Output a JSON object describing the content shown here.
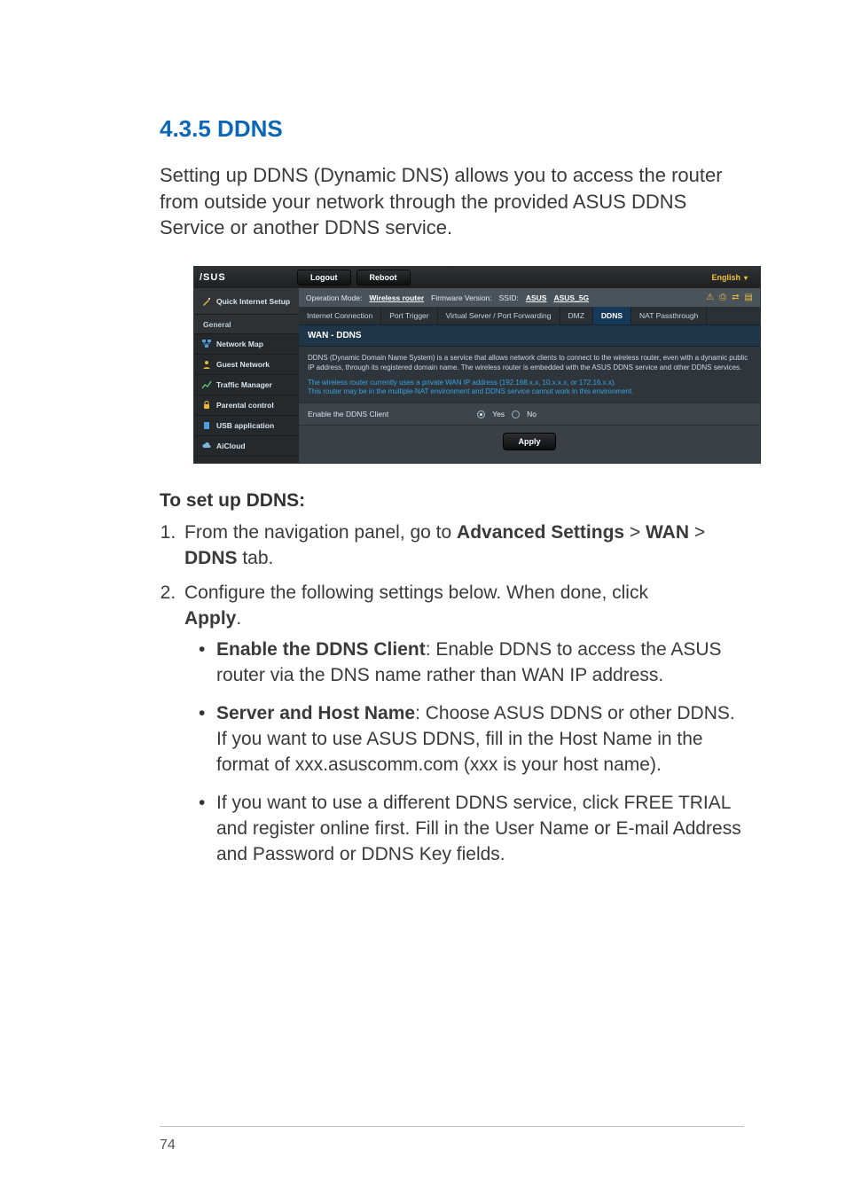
{
  "heading": "4.3.5 DDNS",
  "intro": "Setting up DDNS (Dynamic DNS) allows you to access the router from outside your network through the provided ASUS DDNS Service or another DDNS service.",
  "router": {
    "logo": "/SUS",
    "topButtons": {
      "logout": "Logout",
      "reboot": "Reboot"
    },
    "language": "English",
    "sidebar": {
      "qis": "Quick Internet Setup",
      "generalHeader": "General",
      "items": [
        "Network Map",
        "Guest Network",
        "Traffic Manager",
        "Parental control",
        "USB application",
        "AiCloud"
      ]
    },
    "opmode": {
      "label": "Operation Mode:",
      "mode": "Wireless router",
      "fwLabel": "Firmware Version:",
      "ssidLabel": "SSID:",
      "ssid1": "ASUS",
      "ssid2": "ASUS_5G"
    },
    "tabs": [
      "Internet Connection",
      "Port Trigger",
      "Virtual Server / Port Forwarding",
      "DMZ",
      "DDNS",
      "NAT Passthrough"
    ],
    "activeTab": "DDNS",
    "panelTitle": "WAN - DDNS",
    "desc1": "DDNS (Dynamic Domain Name System) is a service that allows network clients to connect to the wireless router, even with a dynamic public IP address, through its registered domain name. The wireless router is embedded with the ASUS DDNS service and other DDNS services.",
    "desc2a": "The wireless router currently uses a private WAN IP address (192.168.x.x, 10.x.x.x, or 172.16.x.x).",
    "desc2b": "This router may be in the multiple-NAT environment and DDNS service cannot work in this environment.",
    "fieldLabel": "Enable the DDNS Client",
    "radioYes": "Yes",
    "radioNo": "No",
    "applyLabel": "Apply"
  },
  "subhead": "To set up DDNS:",
  "steps": {
    "s1a": "From the navigation panel, go to ",
    "s1b": "Advanced Settings",
    "s1c": " > ",
    "s1d": "WAN",
    "s1e": " > ",
    "s1f": "DDNS",
    "s1g": " tab.",
    "s2a": "Configure the following settings below. When done, click ",
    "s2b": "Apply",
    "s2c": "."
  },
  "bullets": {
    "b1a": "Enable the DDNS Client",
    "b1b": ": Enable DDNS to access the ASUS router via the DNS name rather than WAN IP address.",
    "b2a": "Server and Host Name",
    "b2b": ": Choose ASUS DDNS or other DDNS. If you want to use ASUS DDNS, fill in the Host Name in the format of xxx.asuscomm.com (xxx is your host name).",
    "b3": "If you want to use a different DDNS service, click FREE TRIAL and register online first. Fill in the User Name or E-mail Address and Password or DDNS Key fields."
  },
  "pageNumber": "74"
}
